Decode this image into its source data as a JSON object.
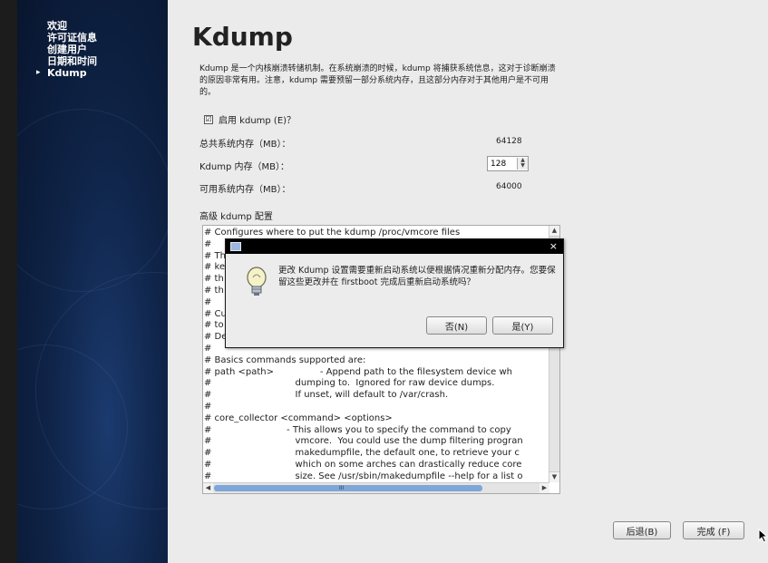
{
  "sidebar": {
    "items": [
      {
        "label": "欢迎",
        "active": false
      },
      {
        "label": "许可证信息",
        "active": false
      },
      {
        "label": "创建用户",
        "active": false
      },
      {
        "label": "日期和时间",
        "active": false
      },
      {
        "label": "Kdump",
        "active": true
      }
    ]
  },
  "page": {
    "title": "Kdump",
    "description": "Kdump 是一个内核崩溃转储机制。在系统崩溃的时候，kdump 将捕获系统信息，这对于诊断崩溃的原因非常有用。注意，kdump 需要预留一部分系统内存，且这部分内存对于其他用户是不可用的。",
    "enable_kdump": {
      "label": "启用 kdump (E)？",
      "checked": true
    },
    "total_memory": {
      "label": "总共系统内存（MB）：",
      "value": "64128"
    },
    "kdump_memory": {
      "label": "Kdump 内存（MB）：",
      "value": "128"
    },
    "usable_memory": {
      "label": "可用系统内存（MB）：",
      "value": "64000"
    },
    "advanced_label": "高级 kdump 配置",
    "config_text": "# Configures where to put the kdump /proc/vmcore files\n#\n# Th\n# ke\n# th\n# th\n#\n# Cu\n# to\n# De\n#\n# Basics commands supported are:\n# path <path>                - Append path to the filesystem device wh\n#                             dumping to.  Ignored for raw device dumps.\n#                             If unset, will default to /var/crash.\n#\n# core_collector <command> <options>\n#                          - This allows you to specify the command to copy\n#                             vmcore.  You could use the dump filtering progran\n#                             makedumpfile, the default one, to retrieve your c\n#                             which on some arches can drastically reduce core\n#                             size. See /usr/sbin/makedumpfile --help for a list o"
  },
  "footer": {
    "back_label": "后退(B)",
    "finish_label": "完成 (F)"
  },
  "dialog": {
    "message": "更改 Kdump 设置需要重新启动系统以便根据情况重新分配内存。您要保留这些更改并在 firstboot 完成后重新启动系统吗？",
    "no_label": "否(N)",
    "yes_label": "是(Y)",
    "close_symbol": "×"
  },
  "icons": {
    "check": "☑",
    "spin_up": "▲",
    "spin_down": "▼",
    "scroll_up": "▲",
    "scroll_down": "▼",
    "scroll_left": "◀",
    "scroll_right": "▶",
    "scroll_grip": "III"
  }
}
